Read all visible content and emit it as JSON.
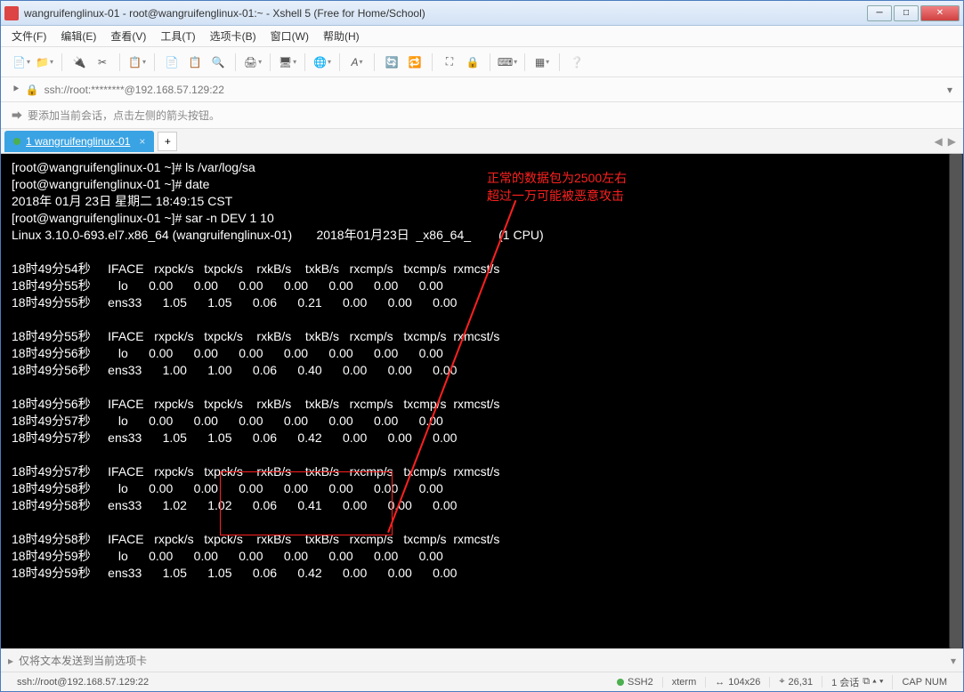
{
  "window": {
    "title": "wangruifenglinux-01 - root@wangruifenglinux-01:~ - Xshell 5 (Free for Home/School)"
  },
  "menu": {
    "file": "文件(F)",
    "edit": "编辑(E)",
    "view": "查看(V)",
    "tools": "工具(T)",
    "tabs": "选项卡(B)",
    "window": "窗口(W)",
    "help": "帮助(H)"
  },
  "addressbar": {
    "url": "ssh://root:********@192.168.57.129:22"
  },
  "hint": {
    "text": "要添加当前会话，点击左侧的箭头按钮。"
  },
  "tab": {
    "label": "1 wangruifenglinux-01"
  },
  "annotation": {
    "line1": "正常的数据包为2500左右",
    "line2": "超过一万可能被恶意攻击"
  },
  "terminal": {
    "lines": [
      "[root@wangruifenglinux-01 ~]# ls /var/log/sa",
      "[root@wangruifenglinux-01 ~]# date",
      "2018年 01月 23日 星期二 18:49:15 CST",
      "[root@wangruifenglinux-01 ~]# sar -n DEV 1 10",
      "Linux 3.10.0-693.el7.x86_64 (wangruifenglinux-01)       2018年01月23日  _x86_64_        (1 CPU)",
      "",
      "18时49分54秒     IFACE   rxpck/s   txpck/s    rxkB/s    txkB/s   rxcmp/s   txcmp/s  rxmcst/s",
      "18时49分55秒        lo      0.00      0.00      0.00      0.00      0.00      0.00      0.00",
      "18时49分55秒     ens33      1.05      1.05      0.06      0.21      0.00      0.00      0.00",
      "",
      "18时49分55秒     IFACE   rxpck/s   txpck/s    rxkB/s    txkB/s   rxcmp/s   txcmp/s  rxmcst/s",
      "18时49分56秒        lo      0.00      0.00      0.00      0.00      0.00      0.00      0.00",
      "18时49分56秒     ens33      1.00      1.00      0.06      0.40      0.00      0.00      0.00",
      "",
      "18时49分56秒     IFACE   rxpck/s   txpck/s    rxkB/s    txkB/s   rxcmp/s   txcmp/s  rxmcst/s",
      "18时49分57秒        lo      0.00      0.00      0.00      0.00      0.00      0.00      0.00",
      "18时49分57秒     ens33      1.05      1.05      0.06      0.42      0.00      0.00      0.00",
      "",
      "18时49分57秒     IFACE   rxpck/s   txpck/s    rxkB/s    txkB/s   rxcmp/s   txcmp/s  rxmcst/s",
      "18时49分58秒        lo      0.00      0.00      0.00      0.00      0.00      0.00      0.00",
      "18时49分58秒     ens33      1.02      1.02      0.06      0.41      0.00      0.00      0.00",
      "",
      "18时49分58秒     IFACE   rxpck/s   txpck/s    rxkB/s    txkB/s   rxcmp/s   txcmp/s  rxmcst/s",
      "18时49分59秒        lo      0.00      0.00      0.00      0.00      0.00      0.00      0.00",
      "18时49分59秒     ens33      1.05      1.05      0.06      0.42      0.00      0.00      0.00"
    ]
  },
  "sendbar": {
    "placeholder": "仅将文本发送到当前选项卡"
  },
  "status": {
    "conn": "ssh://root@192.168.57.129:22",
    "ssh": "SSH2",
    "term": "xterm",
    "size": "104x26",
    "cursor": "26,31",
    "sess": "1 会话",
    "caps": "CAP  NUM"
  }
}
